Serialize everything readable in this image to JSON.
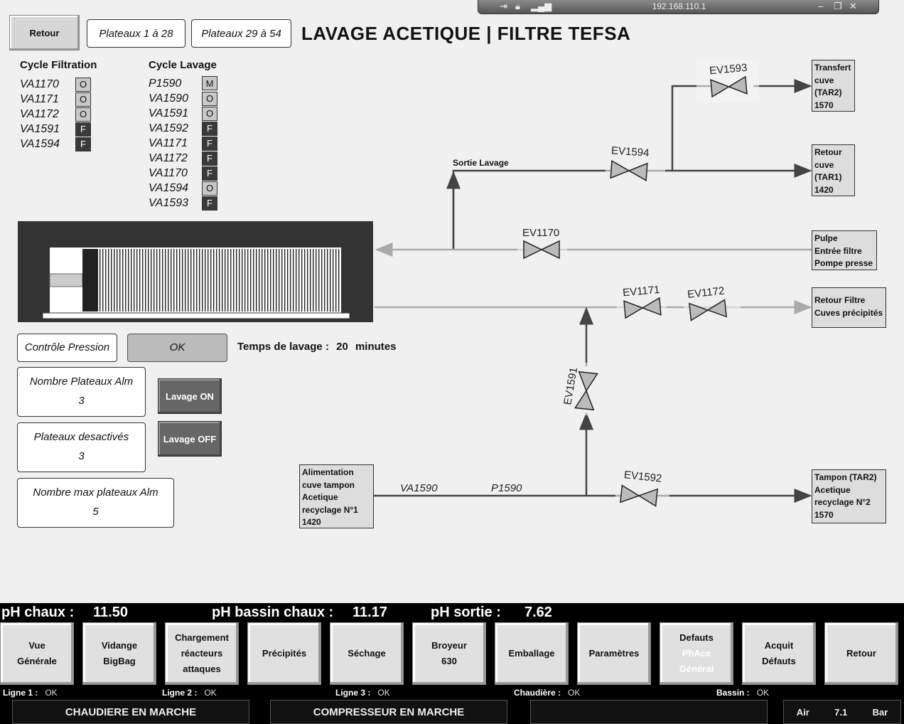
{
  "remote_bar": {
    "ip": "192.168.110.1"
  },
  "header": {
    "back_label": "Retour",
    "plateaux_1": "Plateaux 1 à 28",
    "plateaux_2": "Plateaux 29 à 54",
    "title": "LAVAGE ACETIQUE | FILTRE TEFSA"
  },
  "cycle_filtration": {
    "title": "Cycle Filtration",
    "items": [
      {
        "name": "VA1170",
        "state": "O"
      },
      {
        "name": "VA1171",
        "state": "O"
      },
      {
        "name": "VA1172",
        "state": "O"
      },
      {
        "name": "VA1591",
        "state": "F"
      },
      {
        "name": "VA1594",
        "state": "F"
      }
    ]
  },
  "cycle_lavage": {
    "title": "Cycle Lavage",
    "items": [
      {
        "name": "P1590",
        "state": "M"
      },
      {
        "name": "VA1590",
        "state": "O"
      },
      {
        "name": "VA1591",
        "state": "O"
      },
      {
        "name": "VA1592",
        "state": "F"
      },
      {
        "name": "VA1171",
        "state": "F"
      },
      {
        "name": "VA1172",
        "state": "F"
      },
      {
        "name": "VA1170",
        "state": "F"
      },
      {
        "name": "VA1594",
        "state": "O"
      },
      {
        "name": "VA1593",
        "state": "F"
      }
    ]
  },
  "controls": {
    "controle_pression": "Contrôle Pression",
    "ok": "OK",
    "temps_label": "Temps de lavage :",
    "temps_value": "20",
    "temps_unit": "minutes",
    "nb_plateaux_alm_label": "Nombre Plateaux Alm",
    "nb_plateaux_alm_value": "3",
    "plateaux_desactives_label": "Plateaux desactivés",
    "plateaux_desactives_value": "3",
    "nb_max_label": "Nombre max plateaux Alm",
    "nb_max_value": "5",
    "lavage_on": "Lavage ON",
    "lavage_off": "Lavage OFF"
  },
  "synoptic": {
    "sortie_lavage": "Sortie Lavage",
    "va1590": "VA1590",
    "p1590": "P1590",
    "valves": {
      "ev1593": "EV1593",
      "ev1594": "EV1594",
      "ev1170": "EV1170",
      "ev1171": "EV1171",
      "ev1172": "EV1172",
      "ev1591": "EV1591",
      "ev1592": "EV1592"
    },
    "tags": {
      "transfert": [
        "Transfert",
        "cuve",
        "(TAR2)",
        "1570"
      ],
      "retour_cuve": [
        "Retour",
        "cuve",
        "(TAR1)",
        "1420"
      ],
      "pulpe": [
        "Pulpe",
        "Entrée filtre",
        "Pompe presse"
      ],
      "retour_filtre": [
        "Retour Filtre",
        "Cuves précipités"
      ],
      "alimentation": [
        "Alimentation",
        "cuve tampon",
        "Acetique",
        "recyclage N°1",
        "1420"
      ],
      "tampon": [
        "Tampon (TAR2)",
        "Acetique",
        "recyclage N°2",
        "1570"
      ]
    }
  },
  "ph": {
    "chaux_label": "pH chaux :",
    "chaux_value": "11.50",
    "bassin_label": "pH bassin chaux :",
    "bassin_value": "11.17",
    "sortie_label": "pH sortie :",
    "sortie_value": "7.62"
  },
  "nav": [
    {
      "l1": "Vue",
      "l2": "Générale"
    },
    {
      "l1": "Vidange",
      "l2": "BigBag"
    },
    {
      "l1": "Chargement",
      "l2": "réacteurs",
      "l3": "attaques"
    },
    {
      "l1": "Précipités"
    },
    {
      "l1": "Séchage"
    },
    {
      "l1": "Broyeur",
      "l2": "630"
    },
    {
      "l1": "Emballage"
    },
    {
      "l1": "Paramètres"
    },
    {
      "l1": "Defauts",
      "l2": "PhAce",
      "l3": "Général"
    },
    {
      "l1": "Acquit",
      "l2": "Défauts"
    },
    {
      "l1": "Retour"
    }
  ],
  "lines": {
    "ligne1": "Ligne 1 :",
    "ligne1_v": "OK",
    "ligne2": "Ligne 2 :",
    "ligne2_v": "OK",
    "ligne3": "Ligne 3 :",
    "ligne3_v": "OK",
    "chaudiere": "Chaudière :",
    "chaudiere_v": "OK",
    "bassin": "Bassin :",
    "bassin_v": "OK"
  },
  "status": {
    "chaudiere": "CHAUDIERE EN MARCHE",
    "compresseur": "COMPRESSEUR EN MARCHE",
    "empty": "",
    "air_label": "Air",
    "air_value": "7.1",
    "air_unit": "Bar"
  }
}
